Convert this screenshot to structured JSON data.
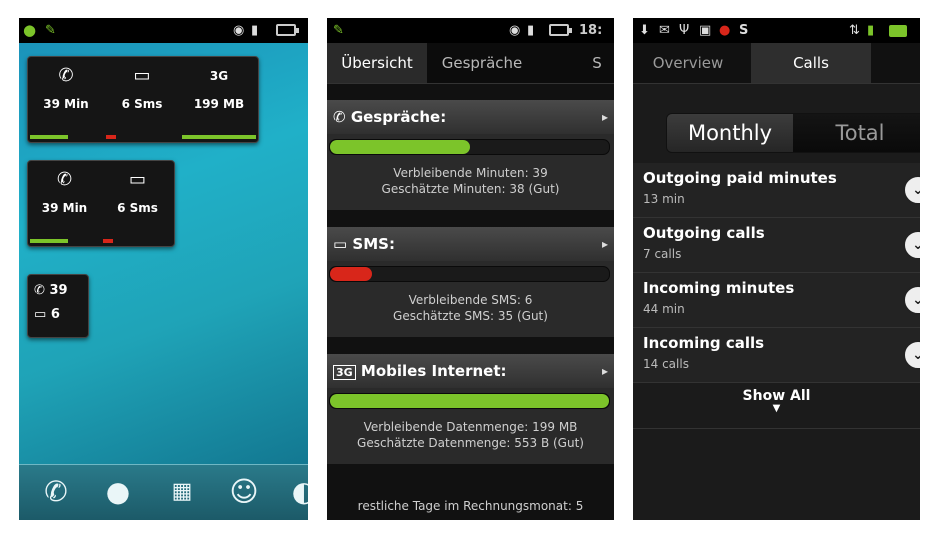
{
  "screen1": {
    "widget_large": {
      "calls": "39 Min",
      "sms": "6 Sms",
      "data": "199 MB",
      "call_fraction": 0.55,
      "sms_fraction": 0.1,
      "data_fraction": 1.0
    },
    "widget_medium": {
      "calls": "39 Min",
      "sms": "6 Sms",
      "call_fraction": 0.55,
      "sms_fraction": 0.1
    },
    "widget_small": {
      "calls": "39",
      "sms": "6"
    },
    "dock": [
      "phone-icon",
      "contacts-icon",
      "apps-grid-icon",
      "messaging-icon",
      "browser-icon"
    ]
  },
  "screen2": {
    "status": {
      "time": "18:"
    },
    "tabs": [
      "Übersicht",
      "Gespräche",
      "S"
    ],
    "calls": {
      "title": "Gespräche:",
      "fraction": 0.5,
      "line1": "Verbleibende Minuten: 39",
      "line2": "Geschätzte Minuten: 38 (Gut)"
    },
    "sms": {
      "title": "SMS:",
      "fraction": 0.15,
      "line1": "Verbleibende SMS: 6",
      "line2": "Geschätzte SMS: 35 (Gut)"
    },
    "internet": {
      "title": "Mobiles Internet:",
      "fraction": 1.0,
      "badge": "3G",
      "line1": "Verbleibende Datenmenge: 199 MB",
      "line2": "Geschätzte Datenmenge: 553 B (Gut)"
    },
    "footer": "restliche Tage im Rechnungsmonat: 5"
  },
  "screen3": {
    "tabs": [
      "Overview",
      "Calls"
    ],
    "segment": {
      "monthly": "Monthly",
      "total": "Total"
    },
    "rows": [
      {
        "title": "Outgoing paid minutes",
        "sub": "13 min"
      },
      {
        "title": "Outgoing calls",
        "sub": "7 calls"
      },
      {
        "title": "Incoming minutes",
        "sub": "44 min"
      },
      {
        "title": "Incoming calls",
        "sub": "14 calls"
      }
    ],
    "show_all": "Show All"
  },
  "colors": {
    "green": "#7cc42a",
    "red": "#d8261a",
    "accent": "#2a2a2a"
  }
}
